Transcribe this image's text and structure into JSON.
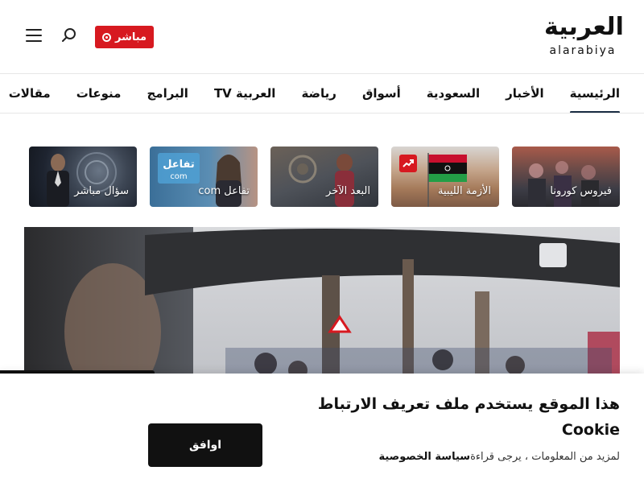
{
  "header": {
    "logo_arabic": "العربية",
    "logo_latin": "alarabiya",
    "live_label": "مباشر",
    "search_icon": "search-icon",
    "menu_icon": "hamburger-menu-icon"
  },
  "nav": {
    "items": [
      {
        "label": "الرئيسية",
        "active": true
      },
      {
        "label": "الأخبار"
      },
      {
        "label": "السعودية"
      },
      {
        "label": "أسواق"
      },
      {
        "label": "رياضة"
      },
      {
        "label": "العربية TV"
      },
      {
        "label": "البرامج"
      },
      {
        "label": "منوعات"
      },
      {
        "label": "مقالات"
      }
    ]
  },
  "topics": [
    {
      "label": "فيروس كورونا"
    },
    {
      "label": "الأزمة الليبية",
      "trending": true
    },
    {
      "label": "البعد الآخر"
    },
    {
      "label": "تفاعل com"
    },
    {
      "label": "سؤال مباشر"
    }
  ],
  "cookie": {
    "title": "هذا الموقع يستخدم ملف تعريف الارتباط Cookie",
    "text_prefix": "لمزيد من المعلومات ، يرجى قراءة",
    "privacy_link": "سياسة الخصوصية",
    "accept_label": "اوافق"
  },
  "colors": {
    "accent_red": "#d71920",
    "nav_underline": "#1b2e44"
  }
}
